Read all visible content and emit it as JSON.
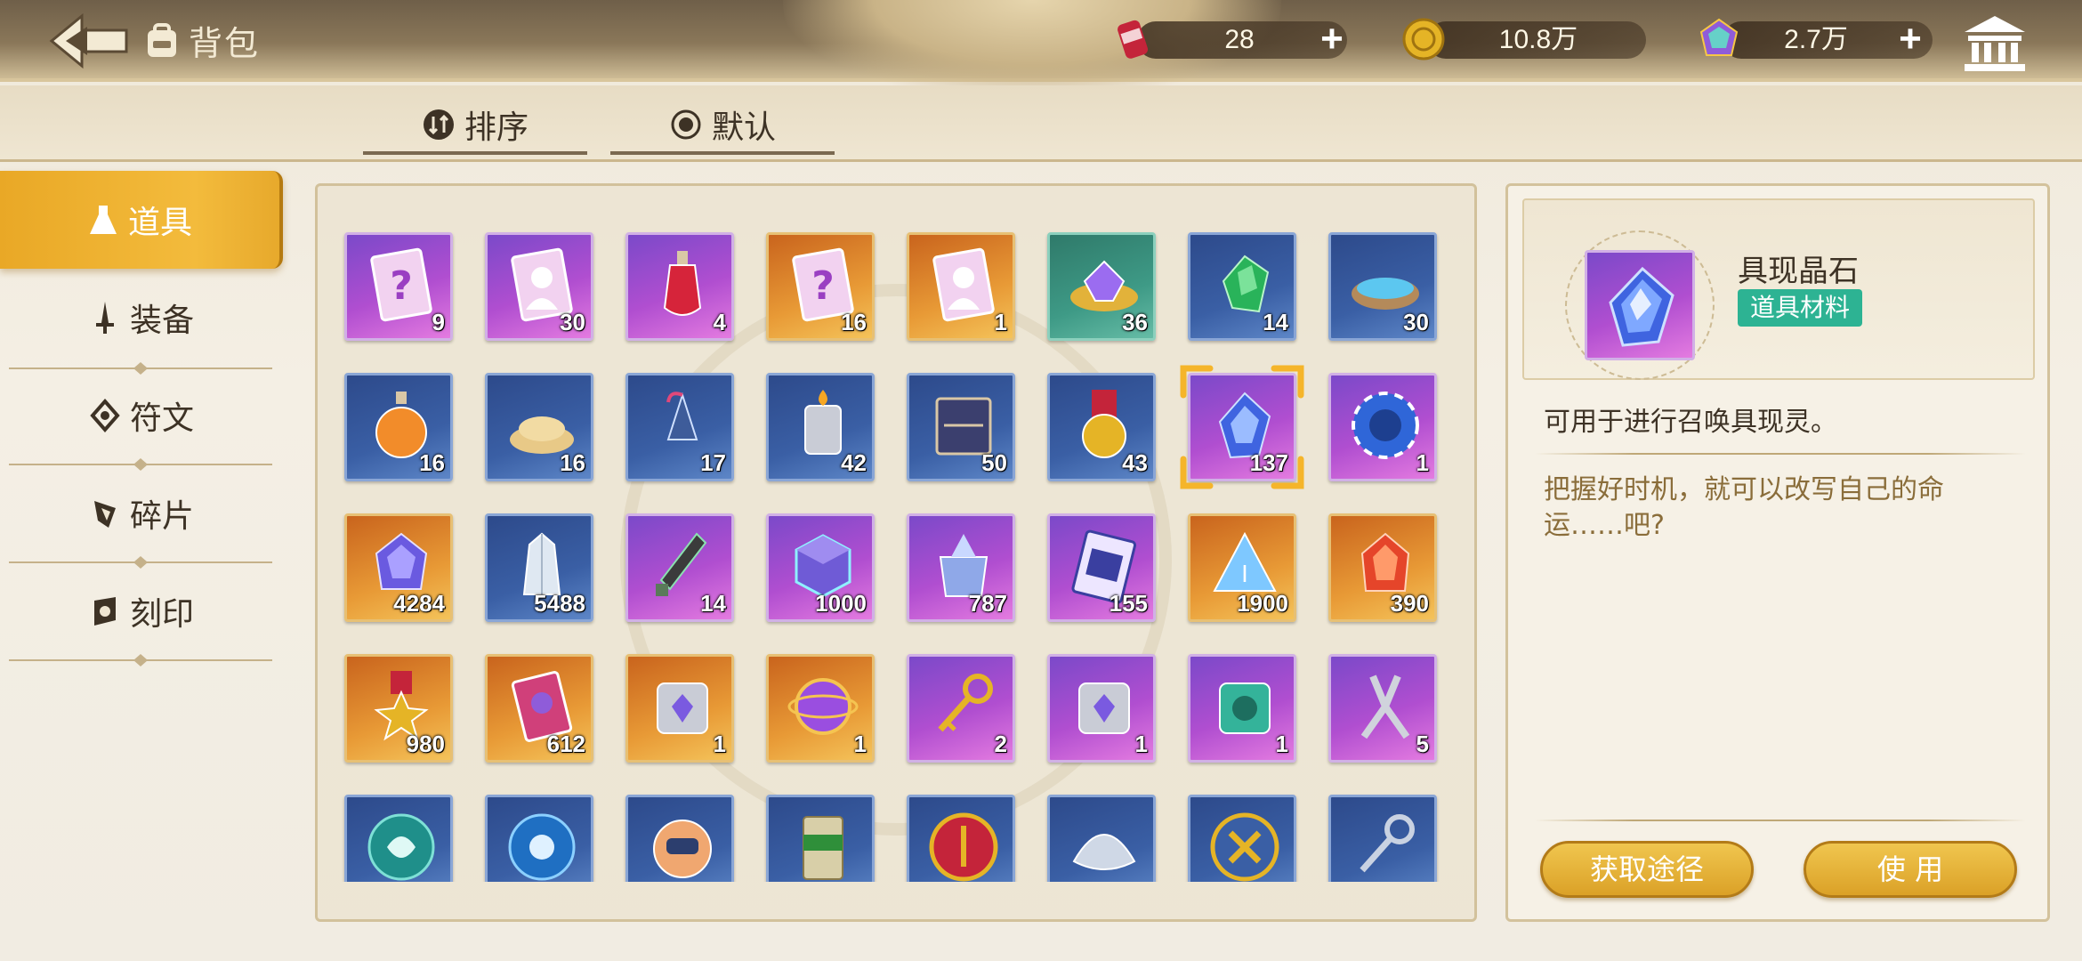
{
  "header": {
    "title": "背包"
  },
  "currencies": [
    {
      "icon": "energy-can-icon",
      "amount": "28"
    },
    {
      "icon": "gold-coin-icon",
      "amount": "10.8万"
    },
    {
      "icon": "rainbow-gem-icon",
      "amount": "2.7万"
    }
  ],
  "sort": {
    "sort_label": "排序",
    "default_label": "默认"
  },
  "sidebar": {
    "items": [
      {
        "label": "道具",
        "icon": "flask-icon",
        "active": true
      },
      {
        "label": "装备",
        "icon": "sword-icon",
        "active": false
      },
      {
        "label": "符文",
        "icon": "rune-icon",
        "active": false
      },
      {
        "label": "碎片",
        "icon": "shard-icon",
        "active": false
      },
      {
        "label": "刻印",
        "icon": "seal-icon",
        "active": false
      }
    ]
  },
  "inventory": [
    [
      {
        "icon": "mystery-card-icon",
        "rarity": "purple",
        "count": "9"
      },
      {
        "icon": "character-card-icon",
        "rarity": "purple",
        "count": "30"
      },
      {
        "icon": "red-potion-icon",
        "rarity": "purple",
        "count": "4"
      },
      {
        "icon": "mystery-card-icon",
        "rarity": "orange",
        "count": "16"
      },
      {
        "icon": "character-card-icon",
        "rarity": "orange",
        "count": "1"
      },
      {
        "icon": "gem-plate-icon",
        "rarity": "green",
        "count": "36"
      },
      {
        "icon": "green-crystal-icon",
        "rarity": "blue",
        "count": "14"
      },
      {
        "icon": "water-bowl-icon",
        "rarity": "blue",
        "count": "30"
      }
    ],
    [
      {
        "icon": "orange-potion-icon",
        "rarity": "blue",
        "count": "16"
      },
      {
        "icon": "grain-pile-icon",
        "rarity": "blue",
        "count": "16"
      },
      {
        "icon": "umbrella-icon",
        "rarity": "blue",
        "count": "17"
      },
      {
        "icon": "lighter-icon",
        "rarity": "blue",
        "count": "42"
      },
      {
        "icon": "book-icon",
        "rarity": "blue",
        "count": "50"
      },
      {
        "icon": "medal-icon",
        "rarity": "blue",
        "count": "43"
      },
      {
        "icon": "blue-crystal-icon",
        "rarity": "purple",
        "count": "137"
      },
      {
        "icon": "poker-chip-icon",
        "rarity": "purple",
        "count": "1"
      }
    ],
    [
      {
        "icon": "purple-gem-icon",
        "rarity": "orange",
        "count": "4284"
      },
      {
        "icon": "white-crystal-icon",
        "rarity": "blue",
        "count": "5488"
      },
      {
        "icon": "dagger-icon",
        "rarity": "purple",
        "count": "14"
      },
      {
        "icon": "cube-icon",
        "rarity": "purple",
        "count": "1000"
      },
      {
        "icon": "crystal-bag-icon",
        "rarity": "purple",
        "count": "787"
      },
      {
        "icon": "ticket-icon",
        "rarity": "purple",
        "count": "155"
      },
      {
        "icon": "pyramid-crystal-icon",
        "rarity": "orange",
        "count": "1900"
      },
      {
        "icon": "red-crystal-icon",
        "rarity": "orange",
        "count": "390"
      }
    ],
    [
      {
        "icon": "star-badge-icon",
        "rarity": "orange",
        "count": "980"
      },
      {
        "icon": "pass-card-icon",
        "rarity": "orange",
        "count": "612"
      },
      {
        "icon": "tin-can-icon",
        "rarity": "orange",
        "count": "1"
      },
      {
        "icon": "orb-icon",
        "rarity": "orange",
        "count": "1"
      },
      {
        "icon": "gold-key-icon",
        "rarity": "purple",
        "count": "2"
      },
      {
        "icon": "tin-can-icon",
        "rarity": "purple",
        "count": "1"
      },
      {
        "icon": "teal-can-icon",
        "rarity": "purple",
        "count": "1"
      },
      {
        "icon": "pliers-icon",
        "rarity": "purple",
        "count": "5"
      }
    ],
    [
      {
        "icon": "teal-token-icon",
        "rarity": "blue",
        "count": ""
      },
      {
        "icon": "blue-token-icon",
        "rarity": "blue",
        "count": ""
      },
      {
        "icon": "robot-icon",
        "rarity": "blue",
        "count": ""
      },
      {
        "icon": "cement-bag-icon",
        "rarity": "blue",
        "count": ""
      },
      {
        "icon": "sword-coin-icon",
        "rarity": "blue",
        "count": ""
      },
      {
        "icon": "shell-icon",
        "rarity": "blue",
        "count": ""
      },
      {
        "icon": "cross-coin-icon",
        "rarity": "blue",
        "count": ""
      },
      {
        "icon": "silver-key-icon",
        "rarity": "blue",
        "count": ""
      }
    ]
  ],
  "selected_item": {
    "name": "具现晶石",
    "tag": "道具材料",
    "description": "可用于进行召唤具现灵。",
    "flavor": "把握好时机，就可以改写自己的命运……吧?",
    "get_button": "获取途径",
    "use_button": "使 用"
  },
  "colors": {
    "accent_gold": "#e9a826",
    "tag_green": "#2db393",
    "rarity_purple": "#b04ed0",
    "rarity_orange": "#e89a36",
    "rarity_blue": "#3a5fa5",
    "rarity_green": "#3e9a86"
  }
}
